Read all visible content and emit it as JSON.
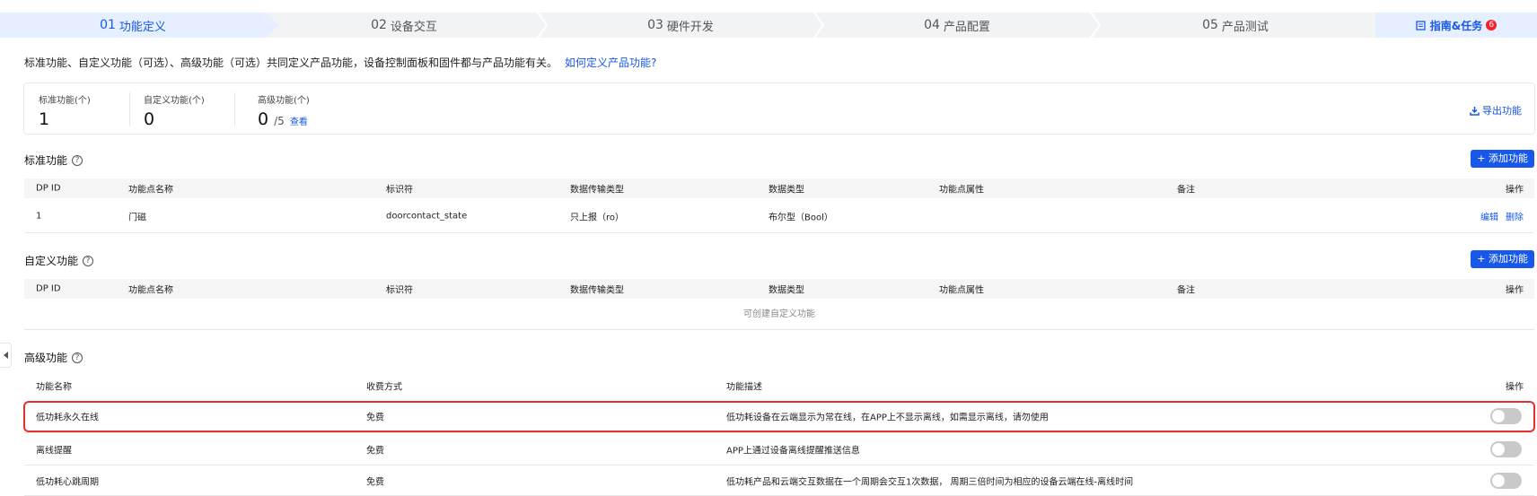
{
  "steps": [
    {
      "num": "01",
      "label": "功能定义"
    },
    {
      "num": "02",
      "label": "设备交互"
    },
    {
      "num": "03",
      "label": "硬件开发"
    },
    {
      "num": "04",
      "label": "产品配置"
    },
    {
      "num": "05",
      "label": "产品测试"
    }
  ],
  "guide": {
    "label": "指南&任务",
    "badge": "6"
  },
  "intro": {
    "text": "标准功能、自定义功能（可选）、高级功能（可选）共同定义产品功能，设备控制面板和固件都与产品功能有关。",
    "link": "如何定义产品功能?"
  },
  "stats": {
    "standard": {
      "label": "标准功能(个)",
      "value": "1"
    },
    "custom": {
      "label": "自定义功能(个)",
      "value": "0"
    },
    "advanced": {
      "label": "高级功能(个)",
      "value": "0",
      "suffix": "/5",
      "link": "查看"
    },
    "export_label": "导出功能"
  },
  "standard_section": {
    "title": "标准功能",
    "add_label": "+ 添加功能",
    "columns": [
      "DP ID",
      "功能点名称",
      "标识符",
      "数据传输类型",
      "数据类型",
      "功能点属性",
      "备注",
      "操作"
    ],
    "rows": [
      {
        "dp_id": "1",
        "name": "门磁",
        "identifier": "doorcontact_state",
        "transfer": "只上报（ro）",
        "dtype": "布尔型（Bool）",
        "props": "",
        "note": "",
        "edit": "编辑",
        "delete": "删除"
      }
    ]
  },
  "custom_section": {
    "title": "自定义功能",
    "add_label": "+ 添加功能",
    "columns": [
      "DP ID",
      "功能点名称",
      "标识符",
      "数据传输类型",
      "数据类型",
      "功能点属性",
      "备注",
      "操作"
    ],
    "empty_text": "可创建自定义功能"
  },
  "advanced_section": {
    "title": "高级功能",
    "columns": [
      "功能名称",
      "收费方式",
      "功能描述",
      "操作"
    ],
    "rows": [
      {
        "name": "低功耗永久在线",
        "charge": "免费",
        "desc": "低功耗设备在云端显示为常在线，在APP上不显示离线，如需显示离线，请勿使用",
        "enabled": false
      },
      {
        "name": "离线提醒",
        "charge": "免费",
        "desc": "APP上通过设备离线提醒推送信息",
        "enabled": false
      },
      {
        "name": "低功耗心跳周期",
        "charge": "免费",
        "desc": "低功耗产品和云端交互数据在一个周期会交互1次数据， 周期三倍时间为相应的设备云端在线-离线时间",
        "enabled": false
      }
    ]
  },
  "colors": {
    "accent": "#1858e8",
    "highlight": "#e53030",
    "badge": "#f5222d"
  }
}
